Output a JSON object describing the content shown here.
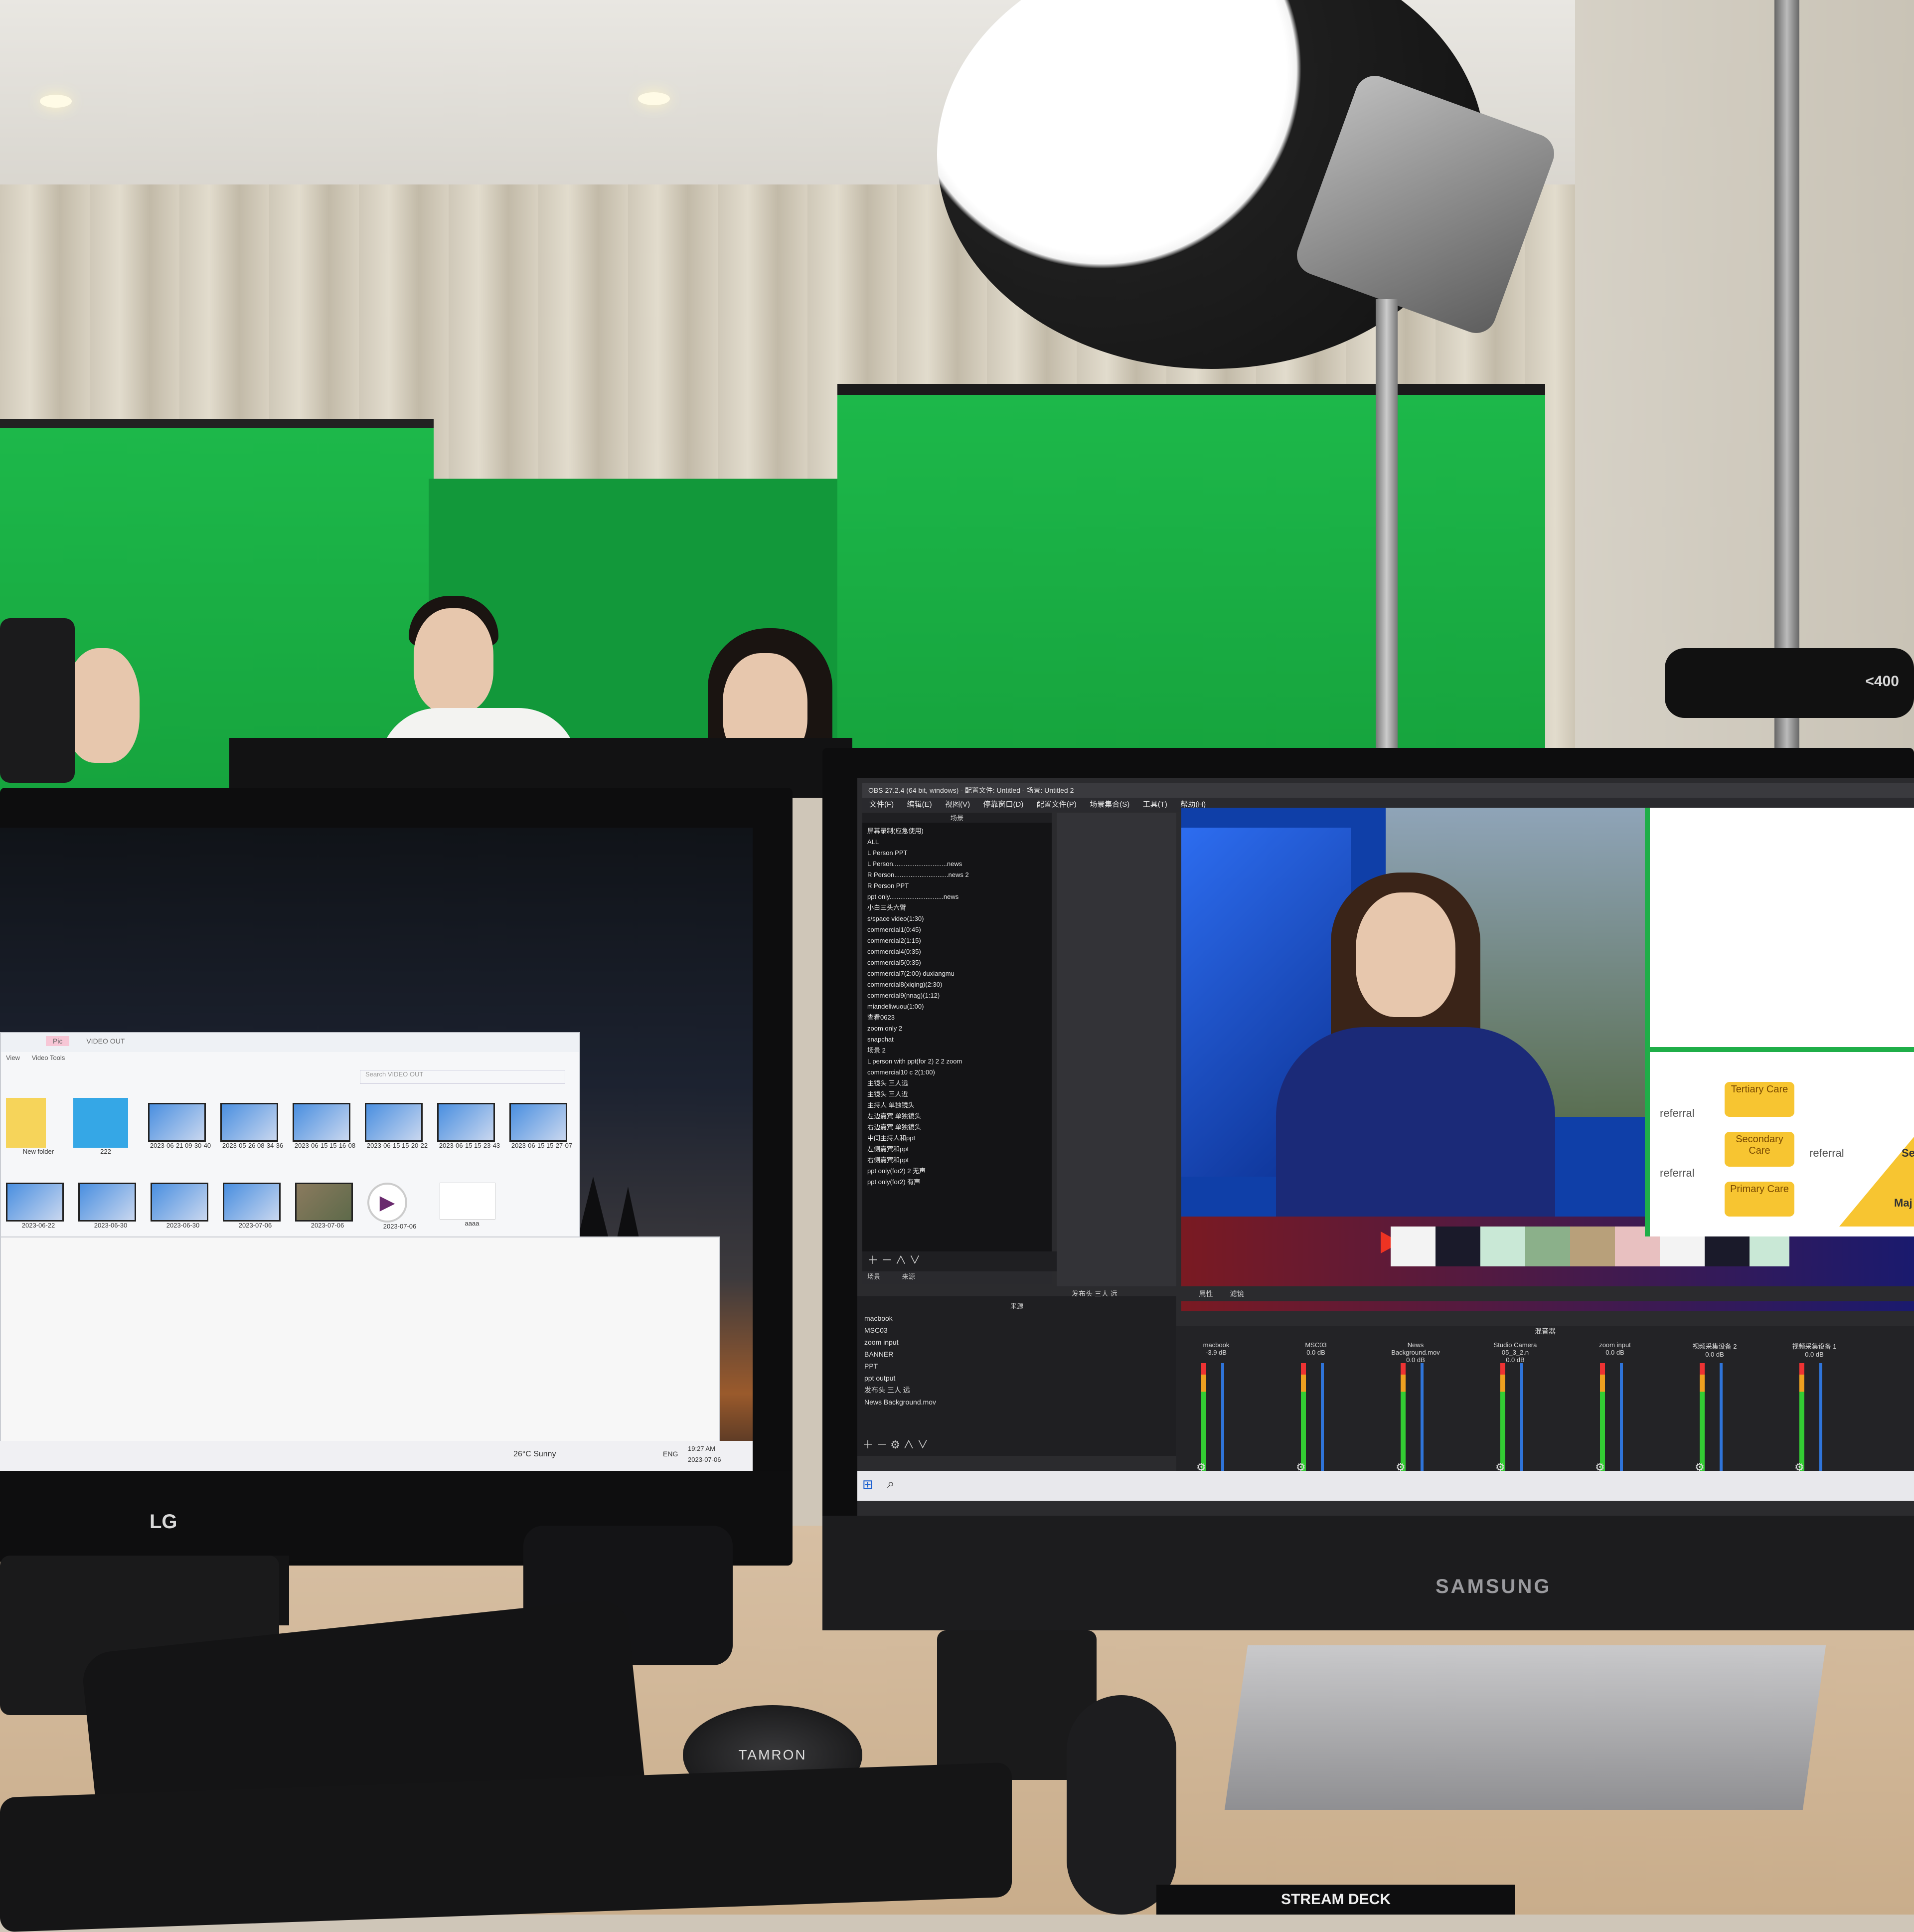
{
  "monitors": {
    "left_brand": "LG",
    "right_brand": "SAMSUNG"
  },
  "explorer": {
    "tab_pic": "Pic",
    "tab_video_out": "VIDEO OUT",
    "menu": [
      "View",
      "Video Tools"
    ],
    "search_placeholder": "Search VIDEO OUT",
    "files_row1": [
      "New folder",
      "222",
      "2023-06-21 09-30-40",
      "2023-05-26 08-34-36",
      "2023-06-15 15-16-08",
      "2023-06-15 15-20-22",
      "2023-06-15 15-23-43",
      "2023-06-15 15-27-07"
    ],
    "files_row2": [
      "2023-06-22",
      "2023-06-30",
      "2023-06-30",
      "2023-07-06",
      "2023-07-06",
      "2023-07-06",
      "aaaa"
    ]
  },
  "lg_taskbar": {
    "weather": "26°C Sunny",
    "lang": "ENG",
    "time": "19:27 AM",
    "date": "2023-07-06"
  },
  "obs": {
    "title": "OBS 27.2.4 (64 bit, windows) - 配置文件: Untitled - 场景: Untitled 2",
    "menu": [
      "文件(F)",
      "编辑(E)",
      "视图(V)",
      "停靠窗口(D)",
      "配置文件(P)",
      "场景集合(S)",
      "工具(T)",
      "帮助(H)"
    ],
    "scenes_header": "场景",
    "scene_list": [
      "屏幕录制(应急使用)",
      "ALL",
      "L Person PPT",
      "L Person..............................news",
      "R Person..............................news 2",
      "R Person PPT",
      "ppt only..............................news",
      "小白三头六臂",
      "s/space video(1:30)",
      "commercial1(0:45)",
      "commercial2(1:15)",
      "commercial4(0:35)",
      "commercial5(0:35)",
      "commercial7(2:00) duxiangmu",
      "commercial8(xiqing)(2:30)",
      "commercial9(nnag)(1:12)",
      "miandeliwuou(1:00)",
      "查看0623",
      "zoom only 2",
      "snapchat",
      "场景 2",
      "L person with ppt(for 2) 2 2 zoom",
      "commercial10 c 2(1:00)",
      "主镜头 三人远",
      "主镜头 三人近",
      "主持人 单独镜头",
      "左边嘉宾 单独镜头",
      "右边嘉宾 单独镜头",
      "中间主持人和ppt",
      "左侧嘉宾和ppt",
      "右侧嘉宾和ppt",
      "ppt only(for2) 2 无声",
      "ppt only(for2) 有声"
    ],
    "scene_label": "发布头 三人 远",
    "tab_scenes": "场景",
    "tab_sources": "来源",
    "sources_header": "来源",
    "sources": [
      "macbook",
      "MSC03",
      "zoom input",
      "BANNER",
      "PPT",
      "ppt output",
      "发布头 三人 远",
      "News Background.mov"
    ],
    "props_button": "属性",
    "filters_button": "滤镜",
    "mixer_header": "混音器",
    "channels": [
      {
        "name": "macbook",
        "db": "-3.9 dB"
      },
      {
        "name": "MSC03",
        "db": "0.0 dB"
      },
      {
        "name": "News Background.mov",
        "db": "0.0 dB"
      },
      {
        "name": "Studio Camera 05_3_2.n",
        "db": "0.0 dB"
      },
      {
        "name": "zoom input",
        "db": "0.0 dB"
      },
      {
        "name": "视频采集设备 2",
        "db": "0.0 dB"
      },
      {
        "name": "视频采集设备 1",
        "db": "0.0 dB"
      }
    ]
  },
  "slide": {
    "nodes": [
      "Tertiary Care",
      "Secondary Care",
      "Primary Care"
    ],
    "labels": [
      "referral",
      "referral",
      "referral",
      "Se",
      "Maj"
    ]
  },
  "objects": {
    "lens_cap": "TAMRON",
    "stream_deck": "STREAM DECK",
    "camera_bar": "<400"
  },
  "colors": {
    "green_screen": "#1db84a",
    "obs_bg": "#2b2b2e",
    "news_blue": "#0f3fa8"
  }
}
